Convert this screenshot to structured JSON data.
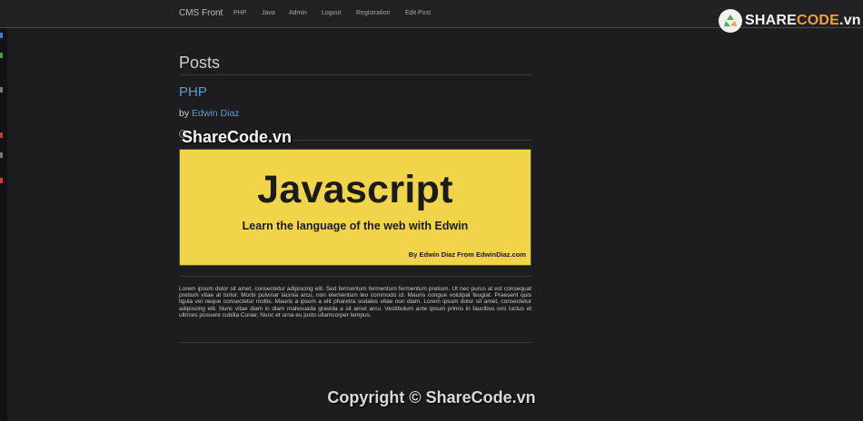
{
  "nav": {
    "brand": "CMS Front",
    "items": [
      "PHP",
      "Java",
      "Admin",
      "Logout",
      "Registration",
      "Edit Post"
    ]
  },
  "watermark": {
    "logo_share": "SHARE",
    "logo_code": "CODE",
    "logo_domain": ".vn",
    "overlay": "ShareCode.vn",
    "copyright": "Copyright © ShareCode.vn"
  },
  "page": {
    "title": "Posts"
  },
  "post": {
    "title": "PHP",
    "by_label": "by",
    "author": "Edwin Diaz",
    "image": {
      "headline": "Javascript",
      "tagline": "Learn the language of the web with Edwin",
      "credit": "By Edwin Diaz From EdwinDiaz.com"
    },
    "excerpt": "Lorem ipsum dolor sit amet, consectetur adipiscing elit. Sed fermentum fermentum fermentum pretium. Ut nec purus at est consequat pretium vitae at tortor. Morbi pulvinar lacinia arcu, non elementum leo commodo id. Mauris congue volutpat feugiat. Praesent quis ligula vel neque consectetur mollis. Mauris a ipsum a elit pharetra sodales vitae non diam. Lorem ipsum dolor sit amet, consectetur adipiscing elit. Nunc vitae diam in diam malesuada gravida a sit amet arcu. Vestibulum ante ipsum primis in faucibus orci luctus et ultrices posuere cubilia Curae; Nunc et urna eu justo ullamcorper tempus."
  },
  "colors": {
    "background": "#1d1d1f",
    "navbar": "#212124",
    "link": "#5b9ad4",
    "image_bg": "#f2d44a",
    "logo_accent": "#f0a13b"
  }
}
